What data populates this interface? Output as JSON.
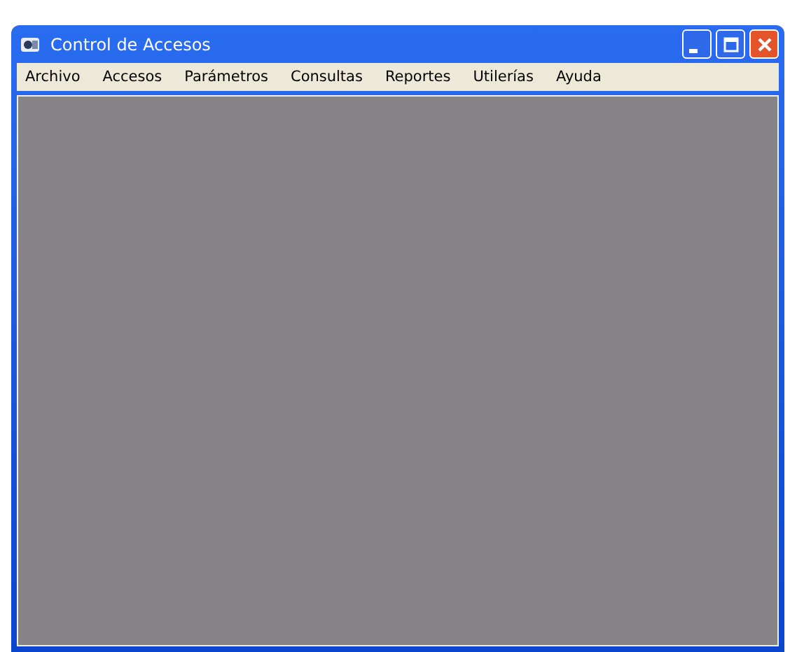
{
  "window": {
    "title": "Control de Accesos"
  },
  "menu": [
    "Archivo",
    "Accesos",
    "Parámetros",
    "Consultas",
    "Reportes",
    "Utilerías",
    "Ayuda"
  ]
}
